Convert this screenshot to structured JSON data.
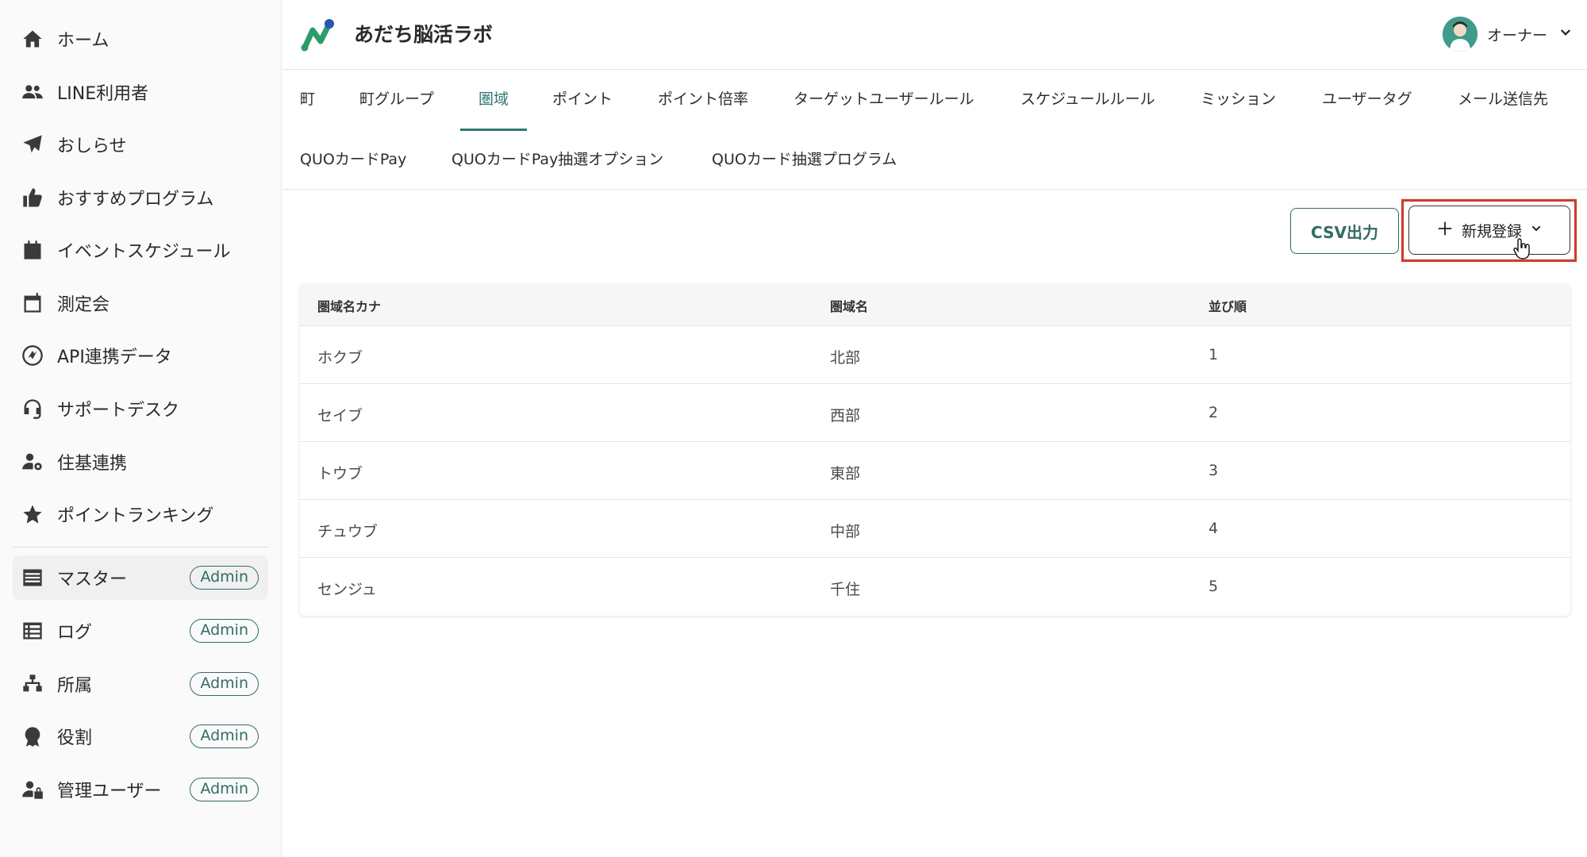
{
  "app": {
    "title": "あだち脳活ラボ"
  },
  "user": {
    "name": "オーナー"
  },
  "sidebar": {
    "items": [
      {
        "label": "ホーム",
        "icon": "home-icon"
      },
      {
        "label": "LINE利用者",
        "icon": "users-icon"
      },
      {
        "label": "おしらせ",
        "icon": "paper-plane-icon"
      },
      {
        "label": "おすすめプログラム",
        "icon": "thumbs-up-icon"
      },
      {
        "label": "イベントスケジュール",
        "icon": "calendar-icon"
      },
      {
        "label": "測定会",
        "icon": "calendar-blank-icon"
      },
      {
        "label": "API連携データ",
        "icon": "api-link-icon"
      },
      {
        "label": "サポートデスク",
        "icon": "headset-icon"
      },
      {
        "label": "住基連携",
        "icon": "user-gear-icon"
      },
      {
        "label": "ポイントランキング",
        "icon": "star-icon"
      },
      {
        "label": "マスター",
        "icon": "master-data-icon",
        "badge": "Admin"
      },
      {
        "label": "ログ",
        "icon": "log-icon",
        "badge": "Admin"
      },
      {
        "label": "所属",
        "icon": "org-tree-icon",
        "badge": "Admin"
      },
      {
        "label": "役割",
        "icon": "role-badge-icon",
        "badge": "Admin"
      },
      {
        "label": "管理ユーザー",
        "icon": "admin-user-icon",
        "badge": "Admin"
      }
    ]
  },
  "tabs": {
    "row1": [
      "町",
      "町グループ",
      "圏域",
      "ポイント",
      "ポイント倍率",
      "ターゲットユーザールール",
      "スケジュールルール",
      "ミッション",
      "ユーザータグ",
      "メール送信先"
    ],
    "row2": [
      "QUOカードPay",
      "QUOカードPay抽選オプション",
      "QUOカード抽選プログラム"
    ],
    "active": "圏域"
  },
  "actions": {
    "csv_label": "CSV出力",
    "new_label": "新規登録"
  },
  "table": {
    "headers": [
      "圏域名カナ",
      "圏域名",
      "並び順"
    ],
    "rows": [
      [
        "ホクブ",
        "北部",
        "1"
      ],
      [
        "セイブ",
        "西部",
        "2"
      ],
      [
        "トウブ",
        "東部",
        "3"
      ],
      [
        "チュウブ",
        "中部",
        "4"
      ],
      [
        "センジュ",
        "千住",
        "5"
      ]
    ]
  },
  "colors": {
    "accent": "#2a7d72",
    "highlight": "#e8321e"
  }
}
